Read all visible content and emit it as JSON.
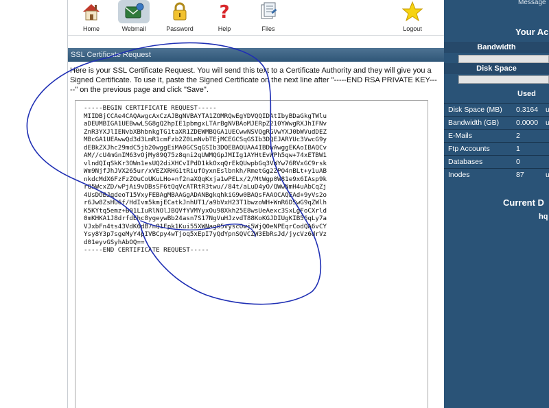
{
  "toolbar": {
    "items": [
      {
        "label": "Home",
        "icon": "home-icon"
      },
      {
        "label": "Webmail",
        "icon": "webmail-icon"
      },
      {
        "label": "Password",
        "icon": "lock-icon"
      },
      {
        "label": "Help",
        "icon": "help-icon"
      },
      {
        "label": "Files",
        "icon": "files-icon"
      },
      {
        "label": "Logout",
        "icon": "star-icon"
      }
    ],
    "active": "Webmail"
  },
  "section": {
    "title": "SSL Certificate Request"
  },
  "intro": "Here is your SSL Certificate Request. You will send this text to a Certificate Authority and they will give you a Signed Certificate. To use it, paste the Signed Certificate on the next line after \"-----END RSA PRIVATE KEY-----\" on the previous page and click \"Save\".",
  "csr": {
    "lines": [
      "-----BEGIN CERTIFICATE REQUEST-----",
      "MIIDBjCCAe4CAQAwgcAxCzAJBgNVBAYTA1ZOMRQwEgYDVQQIDAtIbyBDaGkgTWlu",
      "aDEUMBIGA1UEBwwLSG8gQ2hpIE1pbmgxLTArBgNVBAoMJERpZ210YWwgRXJhIFNv",
      "ZnR3YXJlIENvbXBhbnkgTG1taXR1ZDEWMBQGA1UECwwNSVQgRGVwYXJ0bWVudDEZ",
      "MBcGA1UEAwwQd3d3LmR1cmFzb2Z0LmNvbTEjMCEGCSqGSIb3DQEJARYUc3VwcG9y",
      "dEBkZXJhc29mdC5jb20wggEiMA0GCSqGSIb3DQEBAQUAA4IBDwAwggEKAoIBAQCv",
      "AM//cU4mGnIM63vOjMy89Q75z8qni2qUWMQGpJMIIg1AYHtEvWPh5qw+74xETBW1",
      "vlndQIqSkKr3OWn1esUQ2diXHCvIPdD1kkOxqQrEkQUwpbGq3VWYw76RVxGC9rsk",
      "Wm9NjfJhJVX265ur/xVEZXRHG1tRiufOyxnEslbnkh/RmetGg2ZPO4nBLt+y1uAB",
      "nkdcMdX6FzFzZOuCoUKuLHo+nf2naXQqKxja1wPELx/2/MtWgp0W81e9x6IAsp9k",
      "rQ5WcxZD/wPjAi9vDBsSF6tQqVcATRtR3twu//84t/aLuD4yO/QWwNmH4uAbCqZj",
      "4UsDOBJqdeoT15VxyFEBAgMBAAGgADANBgkqhkiG9w0BAQsFAAOCAQEAd+9yVs2o",
      "r6Jw8ZsHU6f/HdIvm5kmjECatkJnhUT1/a9bVxH23T1bwzoWH+WnR6DSwG9qZWlh",
      "K5KYtq5emz+B01LIuRlNOlJBQVfYVMYyxOu98Xkh25E8wsUeAexc3SxLgFoCXrld",
      "0mKHKA1J8drfdEhc8ygeywBb24asn7S17NgVuHJzvdT88KoKGJDIUgKIB56qLy7a",
      "VJxbFn4ts43VdK6dB7nQ1Fpk1Kui55XWNag05vyscOwj5WjQ0eNPEqrCodQA6vCY",
      "Ysy8Y3p7sgeMyY4pIVBCpy4wTjoq5xEpI7yQdYpnSQVCZW3EbRsJd/jycVz6drVz",
      "d01eyvGSyhAbOQ==",
      "-----END CERTIFICATE REQUEST-----"
    ]
  },
  "sidebar": {
    "messages_link": "Message",
    "your_account": "Your Ac",
    "bandwidth_label": "Bandwidth",
    "disk_space_label": "Disk Space",
    "used_header": "Used",
    "stats": [
      {
        "label": "Disk Space (MB)",
        "value": "0.3164",
        "extra": "u"
      },
      {
        "label": "Bandwidth (GB)",
        "value": "0.0000",
        "extra": "u"
      },
      {
        "label": "E-Mails",
        "value": "2",
        "extra": ""
      },
      {
        "label": "Ftp Accounts",
        "value": "1",
        "extra": ""
      },
      {
        "label": "Databases",
        "value": "0",
        "extra": ""
      },
      {
        "label": "Inodes",
        "value": "87",
        "extra": "u"
      }
    ],
    "current_domain_header": "Current D",
    "current_domain": "hq"
  },
  "colors": {
    "sidebar_bg": "#2a5377",
    "section_bar": "#3d6586",
    "scribble": "#1f2fb4"
  }
}
